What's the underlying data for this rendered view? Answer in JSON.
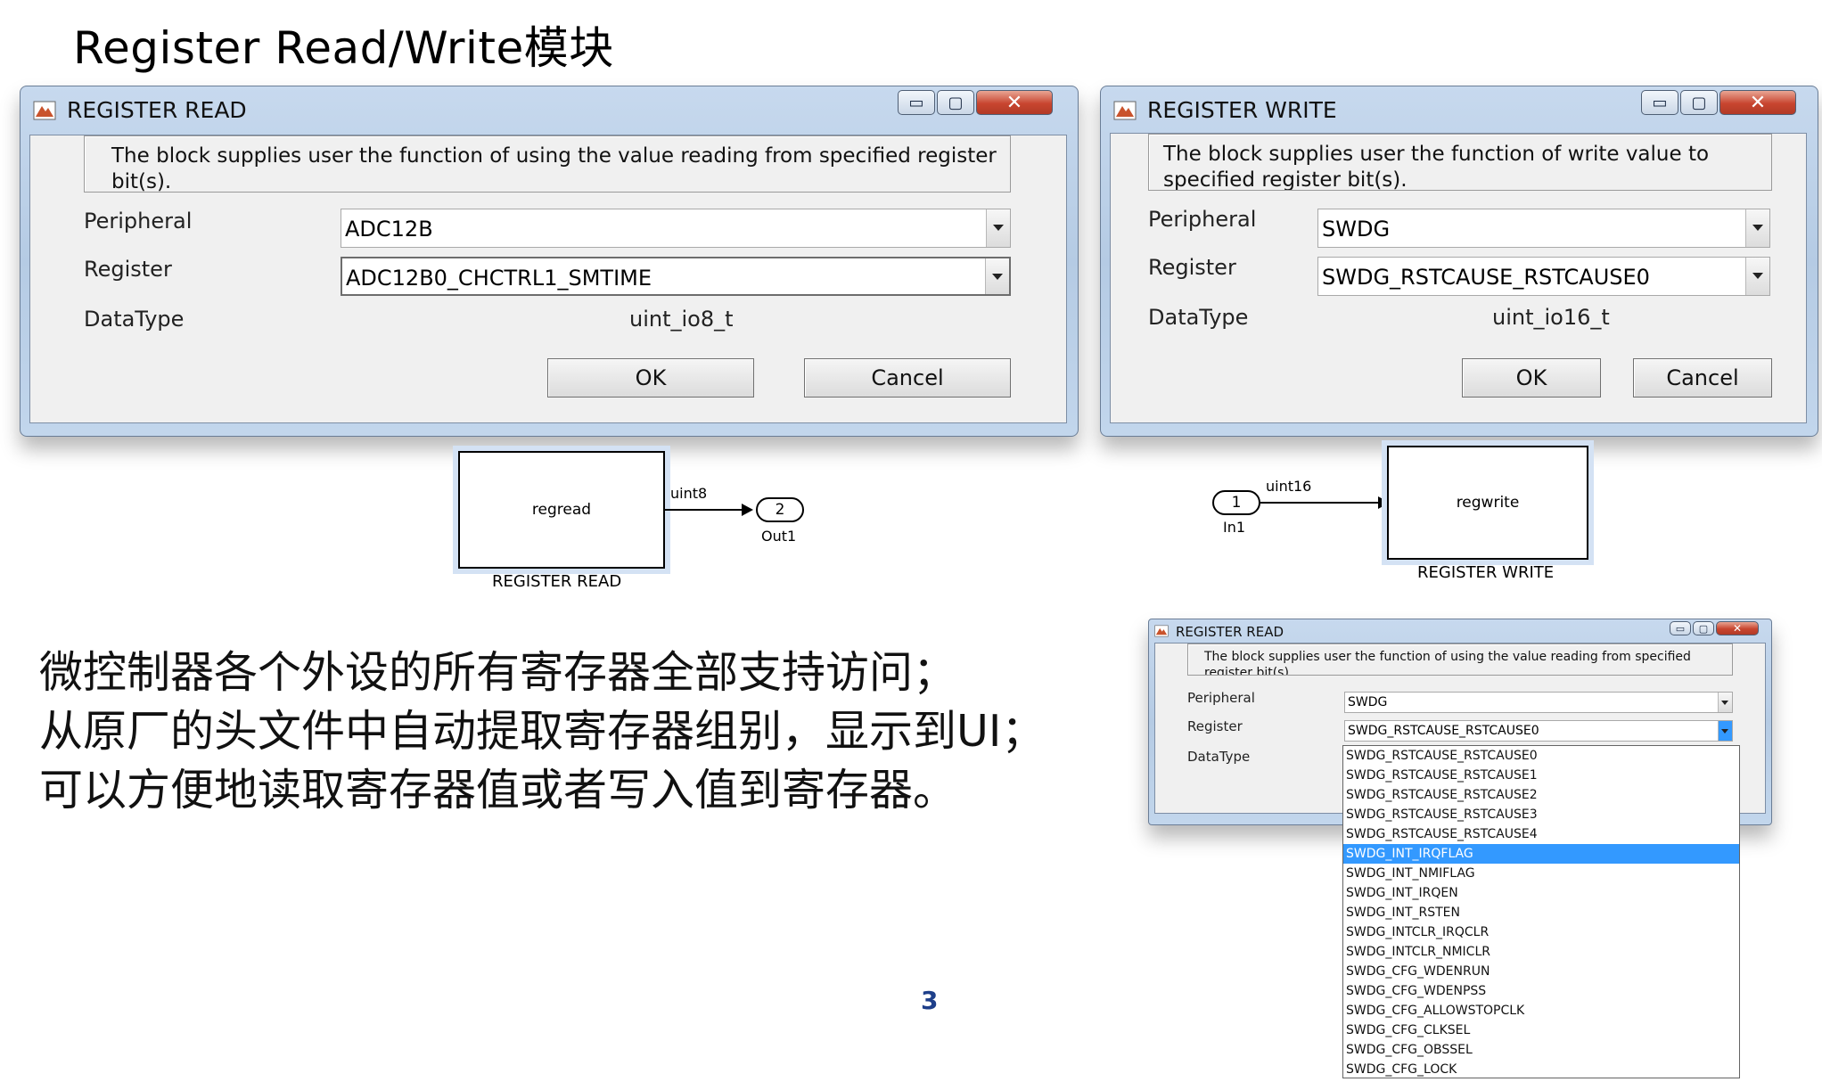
{
  "slide": {
    "title": "Register Read/Write模块",
    "page_number": "3",
    "bullets": [
      "微控制器各个外设的所有寄存器全部支持访问；",
      "从原厂的头文件中自动提取寄存器组别，显示到UI；",
      "可以方便地读取寄存器值或者写入值到寄存器。"
    ]
  },
  "window_controls": {
    "minimize": "▭",
    "maximize": "▢",
    "close": "✕"
  },
  "register_read_dialog": {
    "title": "REGISTER READ",
    "description": "The block supplies user the function of using the value reading from specified register bit(s).",
    "peripheral_label": "Peripheral",
    "peripheral_value": "ADC12B",
    "register_label": "Register",
    "register_value": "ADC12B0_CHCTRL1_SMTIME",
    "datatype_label": "DataType",
    "datatype_value": "uint_io8_t",
    "ok_label": "OK",
    "cancel_label": "Cancel"
  },
  "register_write_dialog": {
    "title": "REGISTER WRITE",
    "description": "The block supplies user the function of write value to specified register bit(s).",
    "peripheral_label": "Peripheral",
    "peripheral_value": "SWDG",
    "register_label": "Register",
    "register_value": "SWDG_RSTCAUSE_RSTCAUSE0",
    "datatype_label": "DataType",
    "datatype_value": "uint_io16_t",
    "ok_label": "OK",
    "cancel_label": "Cancel"
  },
  "read_model": {
    "block_text": "regread",
    "block_label": "REGISTER READ",
    "signal_type": "uint8",
    "out_port_number": "2",
    "out_port_label": "Out1"
  },
  "write_model": {
    "block_text": "regwrite",
    "block_label": "REGISTER WRITE",
    "signal_type": "uint16",
    "in_port_number": "1",
    "in_port_label": "In1"
  },
  "small_read_dialog": {
    "title": "REGISTER READ",
    "description": "The block supplies user the function of using the value reading from specified register bit(s).",
    "peripheral_label": "Peripheral",
    "peripheral_value": "SWDG",
    "register_label": "Register",
    "register_value": "SWDG_RSTCAUSE_RSTCAUSE0",
    "datatype_label": "DataType",
    "selected_option": "SWDG_INT_IRQFLAG",
    "register_options": [
      "SWDG_RSTCAUSE_RSTCAUSE0",
      "SWDG_RSTCAUSE_RSTCAUSE1",
      "SWDG_RSTCAUSE_RSTCAUSE2",
      "SWDG_RSTCAUSE_RSTCAUSE3",
      "SWDG_RSTCAUSE_RSTCAUSE4",
      "SWDG_INT_IRQFLAG",
      "SWDG_INT_NMIFLAG",
      "SWDG_INT_IRQEN",
      "SWDG_INT_RSTEN",
      "SWDG_INTCLR_IRQCLR",
      "SWDG_INTCLR_NMICLR",
      "SWDG_CFG_WDENRUN",
      "SWDG_CFG_WDENPSS",
      "SWDG_CFG_ALLOWSTOPCLK",
      "SWDG_CFG_CLKSEL",
      "SWDG_CFG_OBSSEL",
      "SWDG_CFG_LOCK"
    ]
  }
}
